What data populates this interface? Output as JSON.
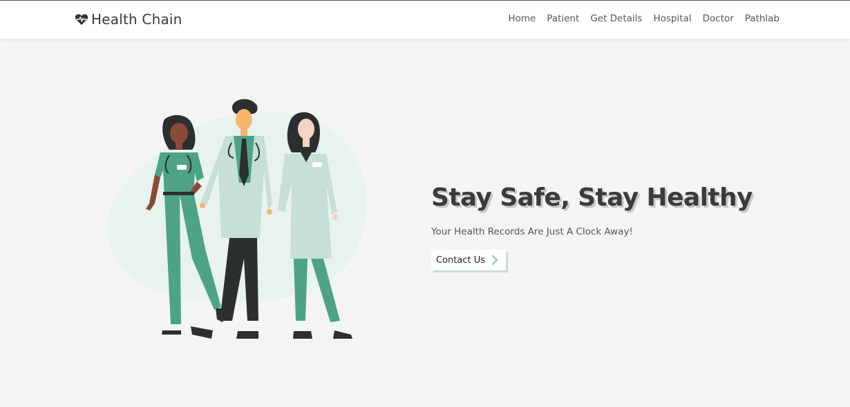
{
  "brand": {
    "name": "Health Chain",
    "icon": "heart-pulse-icon"
  },
  "nav": {
    "items": [
      {
        "label": "Home"
      },
      {
        "label": "Patient"
      },
      {
        "label": "Get Details"
      },
      {
        "label": "Hospital"
      },
      {
        "label": "Doctor"
      },
      {
        "label": "Pathlab"
      }
    ]
  },
  "hero": {
    "title": "Stay Safe, Stay Healthy",
    "subtitle": "Your Health Records Are Just A Clock Away!",
    "cta_label": "Contact Us"
  },
  "colors": {
    "background": "#f4f4f4",
    "navbar": "#ffffff",
    "scrub_green": "#4ea386",
    "coat_mint": "#c6e0d8",
    "dark": "#2b2f2f"
  }
}
